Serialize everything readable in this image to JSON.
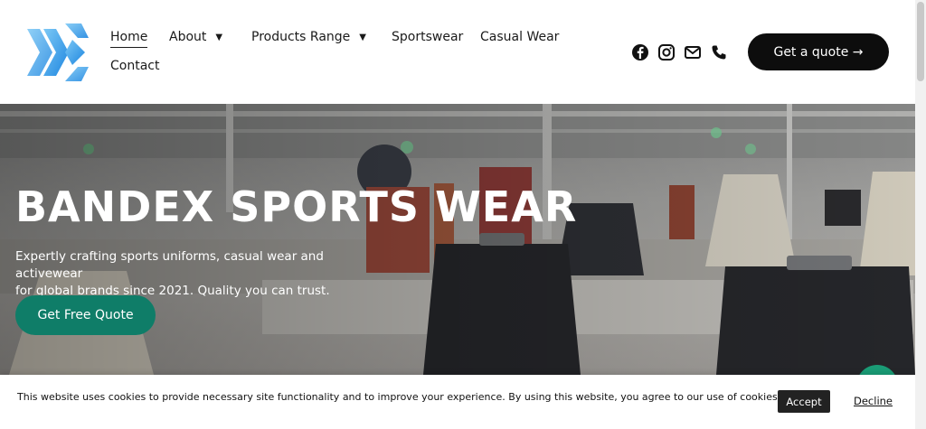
{
  "header": {
    "nav": [
      {
        "label": "Home",
        "active": true,
        "dropdown": false
      },
      {
        "label": "About",
        "active": false,
        "dropdown": true
      },
      {
        "label": "Products Range",
        "active": false,
        "dropdown": true
      },
      {
        "label": "Sportswear",
        "active": false,
        "dropdown": false
      },
      {
        "label": "Casual Wear",
        "active": false,
        "dropdown": false
      },
      {
        "label": "Contact",
        "active": false,
        "dropdown": false
      }
    ],
    "dropdown_icon": "chevron-down-icon",
    "socials": [
      "facebook-icon",
      "instagram-icon",
      "mail-icon",
      "phone-icon"
    ],
    "quote_button": "Get a quote →"
  },
  "hero": {
    "title": "BANDEX SPORTS WEAR",
    "subtitle_line1": "Expertly crafting sports uniforms, casual wear and activewear",
    "subtitle_line2": "for global brands since 2021. Quality you can trust.",
    "cta": "Get Free Quote"
  },
  "cookie": {
    "text": "This website uses cookies to provide necessary site functionality and to improve your experience. By using this website, you agree to our use of cookies.",
    "accept": "Accept",
    "decline": "Decline"
  },
  "colors": {
    "accent": "#0f7d68",
    "logo_blue": "#3aa0e8",
    "dark": "#0d0d0d"
  }
}
